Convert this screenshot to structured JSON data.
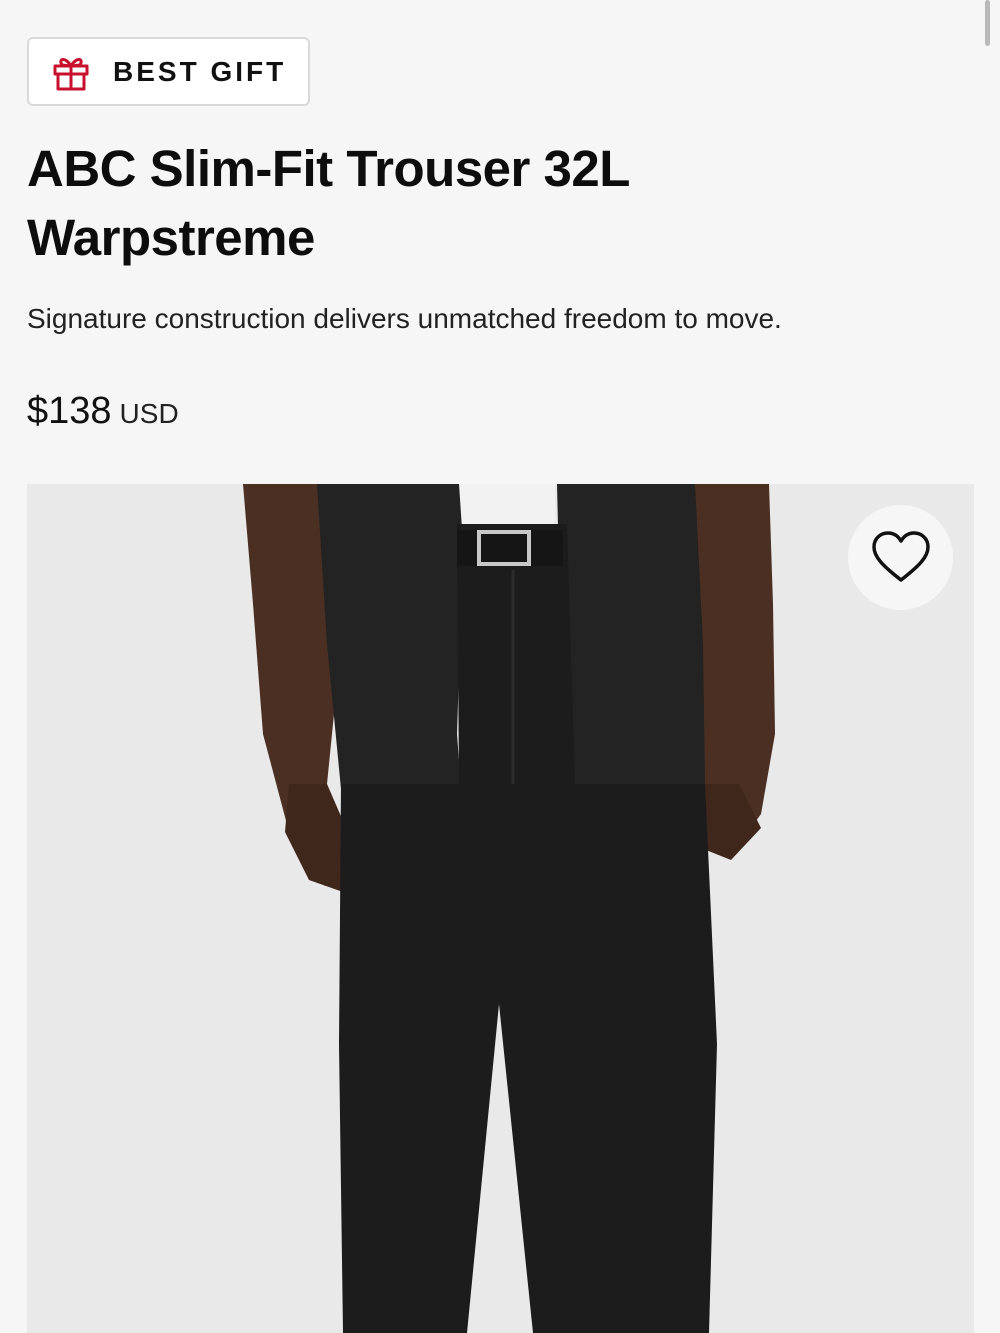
{
  "badge": {
    "label": "BEST GIFT",
    "icon": "gift-icon",
    "icon_color": "#c8102e"
  },
  "product": {
    "title": "ABC Slim-Fit Trouser 32L Warpstreme",
    "description": "Signature construction delivers unmatched freedom to move.",
    "price": "$138",
    "currency": "USD"
  },
  "image": {
    "alt": "Model wearing black slim-fit trousers with a black short-sleeve shirt and belt",
    "wishlist_icon": "heart-outline-icon"
  },
  "colors": {
    "background": "#f6f6f6",
    "text": "#111111",
    "badge_border": "#d9d9d9",
    "accent": "#c8102e"
  }
}
